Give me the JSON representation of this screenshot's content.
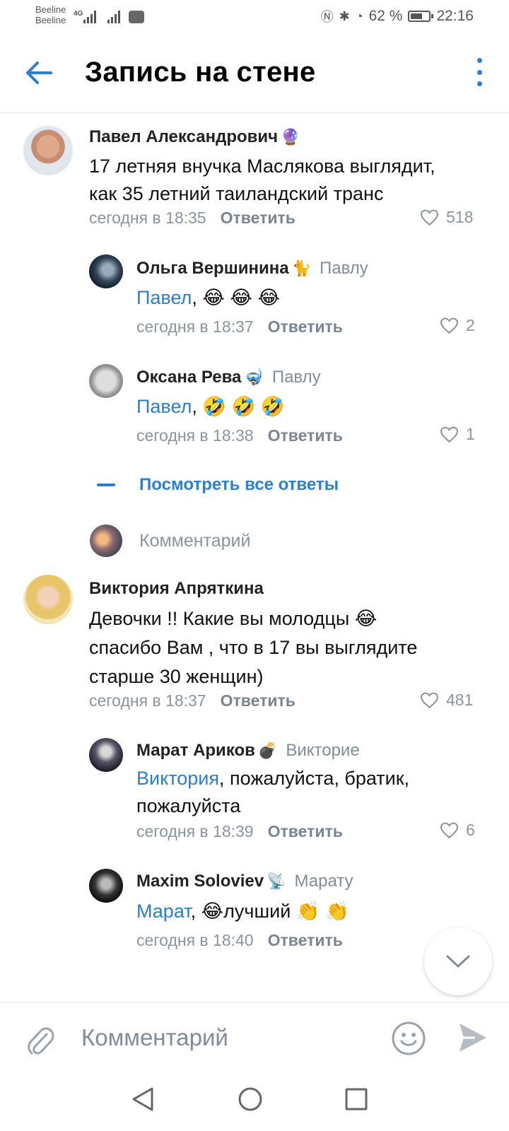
{
  "status_bar": {
    "carrier1": "Beeline",
    "carrier2": "Beeline",
    "network": "4G",
    "battery": "62 %",
    "time": "22:16"
  },
  "header": {
    "title": "Запись на стене"
  },
  "comments": [
    {
      "author": "Павел Александрович",
      "author_emoji": "🔮",
      "text_lines": [
        "17 летняя внучка Маслякова выглядит,",
        "как 35 летний таиландский транс"
      ],
      "time": "сегодня в 18:35",
      "reply_label": "Ответить",
      "likes": "518",
      "replies": [
        {
          "author": "Ольга Вершинина",
          "author_emoji": "🐈",
          "to": "Павлу",
          "mention": "Павел",
          "text": ", 😂 😂 😂",
          "time": "сегодня в 18:37",
          "reply_label": "Ответить",
          "likes": "2"
        },
        {
          "author": "Оксана Рева",
          "author_emoji": "🤿",
          "to": "Павлу",
          "mention": "Павел",
          "text": ", 🤣 🤣 🤣",
          "time": "сегодня в 18:38",
          "reply_label": "Ответить",
          "likes": "1"
        }
      ],
      "see_all_label": "Посмотреть все ответы",
      "comment_placeholder": "Комментарий"
    },
    {
      "author": "Виктория Апряткина",
      "text_lines": [
        "Девочки !! Какие вы молодцы 😂",
        "спасибо Вам , что в 17 вы выглядите",
        "старше 30 женщин)"
      ],
      "time": "сегодня в 18:37",
      "reply_label": "Ответить",
      "likes": "481",
      "replies": [
        {
          "author": "Марат Ариков",
          "author_emoji": "💣",
          "to": "Викторие",
          "mention": "Виктория",
          "text": ", пожалуйста, братик,",
          "text2": "пожалуйста",
          "time": "сегодня в 18:39",
          "reply_label": "Ответить",
          "likes": "6"
        },
        {
          "author": "Maxim Soloviev",
          "author_emoji": "📡",
          "to": "Марату",
          "mention": "Марат",
          "text": ", 😂лучший 👏 👏",
          "time": "сегодня в 18:40",
          "reply_label": "Ответить"
        }
      ]
    }
  ],
  "composer": {
    "placeholder": "Комментарий"
  },
  "colors": {
    "accent": "#2a80d1",
    "secondary_text": "#818c99"
  },
  "icons": [
    "arrow-back-icon",
    "more-vertical-icon",
    "heart-icon",
    "attach-icon",
    "smile-icon",
    "send-icon",
    "chevron-down-icon",
    "nav-back-icon",
    "nav-home-icon",
    "nav-recents-icon"
  ]
}
